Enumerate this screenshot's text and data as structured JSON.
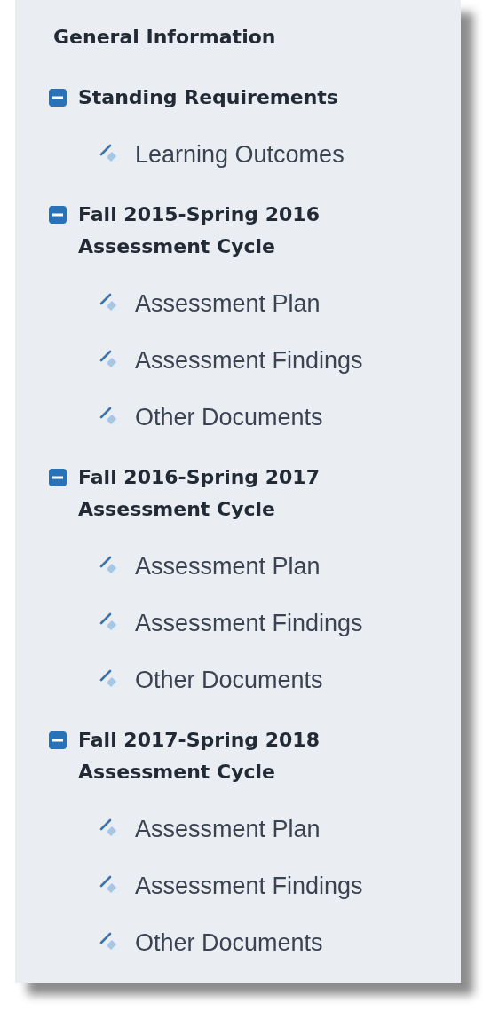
{
  "header": {
    "title": "General Information"
  },
  "sections": [
    {
      "title": "Standing Requirements",
      "expanded": true,
      "children": [
        {
          "label": "Learning Outcomes"
        }
      ]
    },
    {
      "title": "Fall 2015-Spring 2016 Assessment Cycle",
      "expanded": true,
      "children": [
        {
          "label": "Assessment Plan"
        },
        {
          "label": "Assessment Findings"
        },
        {
          "label": "Other Documents"
        }
      ]
    },
    {
      "title": "Fall 2016-Spring 2017 Assessment Cycle",
      "expanded": true,
      "children": [
        {
          "label": "Assessment Plan"
        },
        {
          "label": "Assessment Findings"
        },
        {
          "label": "Other Documents"
        }
      ]
    },
    {
      "title": "Fall 2017-Spring 2018 Assessment Cycle",
      "expanded": true,
      "children": [
        {
          "label": "Assessment Plan"
        },
        {
          "label": "Assessment Findings"
        },
        {
          "label": "Other Documents"
        }
      ]
    }
  ]
}
